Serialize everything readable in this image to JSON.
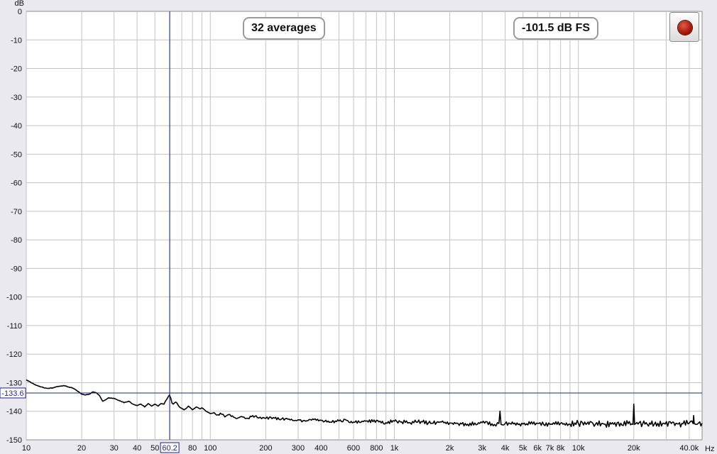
{
  "averages_label": "32 averages",
  "level_readout": "-101.5 dB FS",
  "cursor": {
    "x_label": "60.2",
    "y_label": "-133.6"
  },
  "record_button": {
    "state": "idle",
    "color": "#b01a10"
  },
  "chart_data": {
    "type": "line",
    "title": "",
    "xlabel": "Hz",
    "ylabel": "dB",
    "xscale": "log",
    "xlim": [
      10,
      47000
    ],
    "ylim": [
      -150,
      0
    ],
    "grid": true,
    "y_ticks": [
      0,
      -10,
      -20,
      -30,
      -40,
      -50,
      -60,
      -70,
      -80,
      -90,
      -100,
      -110,
      -120,
      -130,
      -140,
      -150
    ],
    "y_tick_labels": [
      "0",
      "-10",
      "-20",
      "-30",
      "-40",
      "-50",
      "-60",
      "-70",
      "-80",
      "-90",
      "-100",
      "-110",
      "-120",
      "-130",
      "-140",
      "-150"
    ],
    "x_ticks": [
      10,
      20,
      30,
      40,
      50,
      80,
      100,
      200,
      300,
      400,
      600,
      800,
      1000,
      2000,
      3000,
      4000,
      5000,
      6000,
      7000,
      8000,
      10000,
      20000,
      40000
    ],
    "x_tick_labels": [
      "10",
      "20",
      "30",
      "40",
      "50",
      "80",
      "100",
      "200",
      "300",
      "400",
      "600",
      "800",
      "1k",
      "2k",
      "3k",
      "4k",
      "5k",
      "6k",
      "7k",
      "8k",
      "10k",
      "20k",
      "40.0k"
    ],
    "grid_x": [
      10,
      20,
      30,
      40,
      50,
      60,
      70,
      80,
      90,
      100,
      200,
      300,
      400,
      500,
      600,
      700,
      800,
      900,
      1000,
      2000,
      3000,
      4000,
      5000,
      6000,
      7000,
      8000,
      9000,
      10000,
      20000,
      30000,
      40000
    ],
    "cursor_x": 60.2,
    "cursor_y": -133.6,
    "series": [
      {
        "color": "#000000",
        "x": [
          10,
          11,
          12,
          13,
          14,
          15,
          16,
          17,
          18,
          19,
          20,
          21,
          22,
          23,
          24,
          25,
          26,
          27,
          28,
          29,
          30,
          32,
          34,
          36,
          38,
          40,
          42,
          44,
          46,
          48,
          50,
          52,
          54,
          56,
          57,
          58,
          59,
          60,
          61,
          62,
          63,
          64,
          65,
          66,
          68,
          70,
          72,
          74,
          76,
          78,
          80,
          82,
          84,
          86,
          88,
          90,
          93,
          96,
          100,
          105,
          110,
          115,
          120,
          125,
          130,
          140,
          150,
          160,
          170,
          180,
          190,
          200,
          220,
          240,
          260,
          280,
          300,
          330,
          360,
          400,
          450,
          500,
          550,
          600,
          700,
          800,
          900,
          1000,
          1200,
          1400,
          1600,
          1800,
          2000,
          2500,
          3000,
          3500,
          3700,
          3750,
          3800,
          4000,
          5000,
          6000,
          7000,
          8000,
          9000,
          10000,
          11000,
          11300,
          11400,
          12000,
          14000,
          17000,
          19500,
          19800,
          20000,
          20200,
          20500,
          23000,
          27000,
          32000,
          37000,
          40000,
          42000,
          42300,
          42600,
          45000,
          47000
        ],
        "y": [
          -129,
          -130.5,
          -131.5,
          -132,
          -131.8,
          -131.3,
          -131,
          -131.5,
          -132,
          -133,
          -134,
          -134.3,
          -134,
          -133.2,
          -133.5,
          -134.5,
          -136.5,
          -136,
          -135.3,
          -135.4,
          -135.5,
          -136.3,
          -137,
          -136.5,
          -137.5,
          -138,
          -137.5,
          -138.5,
          -137.3,
          -138.2,
          -137.5,
          -138.2,
          -137.3,
          -137.5,
          -136.5,
          -135.8,
          -135,
          -134.3,
          -135.5,
          -137.2,
          -137.5,
          -137,
          -136.8,
          -137.2,
          -138.5,
          -139,
          -139.5,
          -139,
          -138.2,
          -138.8,
          -139.5,
          -139,
          -138.5,
          -138.8,
          -139.2,
          -138.8,
          -139.5,
          -140.2,
          -140.8,
          -140.5,
          -141.2,
          -141,
          -142,
          -141.2,
          -141.8,
          -142.5,
          -142,
          -142.5,
          -141.5,
          -142.2,
          -142.6,
          -142.5,
          -142.2,
          -143,
          -142.5,
          -143.2,
          -143,
          -143.5,
          -142.7,
          -143.2,
          -143.8,
          -143.4,
          -143.2,
          -143.8,
          -143.5,
          -143.2,
          -144,
          -143.5,
          -144,
          -143.6,
          -144.2,
          -143.8,
          -144.1,
          -144.5,
          -144,
          -144.6,
          -144.3,
          -140,
          -144.6,
          -144.3,
          -144.5,
          -144.2,
          -144.6,
          -144.2,
          -144.5,
          -144.3,
          -144.6,
          -143.8,
          -144.6,
          -144.3,
          -144.5,
          -144.2,
          -144.4,
          -144.6,
          -137.5,
          -144.6,
          -144.3,
          -144.5,
          -144.2,
          -144.3,
          -144.4,
          -144.2,
          -144.3,
          -141.5,
          -144.3,
          -144.1,
          -144.2
        ]
      }
    ]
  }
}
